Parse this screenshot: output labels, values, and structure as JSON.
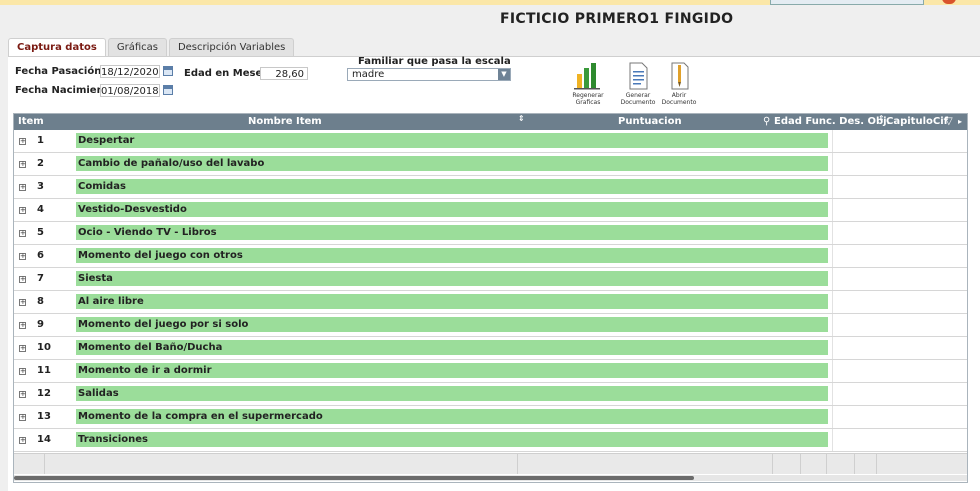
{
  "header": {
    "patient_name": "FICTICIO PRIMERO1 FINGIDO"
  },
  "tabs": [
    {
      "label": "Captura datos",
      "active": true
    },
    {
      "label": "Gráficas",
      "active": false
    },
    {
      "label": "Descripción Variables",
      "active": false
    }
  ],
  "form": {
    "fecha_pasacion_label": "Fecha Pasación",
    "fecha_pasacion_value": "18/12/2020",
    "fecha_nacimiento_label": "Fecha Nacimiento",
    "fecha_nacimiento_value": "01/08/2018",
    "edad_meses_label": "Edad en Meses",
    "edad_meses_value": "28,60",
    "familiar_label": "Familiar que pasa la escala",
    "familiar_value": "madre"
  },
  "toolbar": {
    "regenerar_line1": "Regenerar",
    "regenerar_line2": "Graficas",
    "generar_line1": "Generar",
    "generar_line2": "Documento",
    "abrir_line1": "Abrir",
    "abrir_line2": "Documento"
  },
  "grid": {
    "columns": {
      "item": "Item",
      "nombre": "Nombre Item",
      "puntuacion": "Puntuacion",
      "edad": "Edad Func. Des. Obj.",
      "capitulo": "CapituloCif"
    },
    "rows": [
      {
        "num": "1",
        "name": "Despertar"
      },
      {
        "num": "2",
        "name": "Cambio de pañalo/uso del lavabo"
      },
      {
        "num": "3",
        "name": "Comidas"
      },
      {
        "num": "4",
        "name": "Vestido-Desvestido"
      },
      {
        "num": "5",
        "name": "Ocio - Viendo TV - Libros"
      },
      {
        "num": "6",
        "name": "Momento del juego con otros"
      },
      {
        "num": "7",
        "name": "Siesta"
      },
      {
        "num": "8",
        "name": "Al aire libre"
      },
      {
        "num": "9",
        "name": "Momento del juego por si solo"
      },
      {
        "num": "10",
        "name": "Momento del Baño/Ducha"
      },
      {
        "num": "11",
        "name": "Momento de ir a dormir"
      },
      {
        "num": "12",
        "name": "Salidas"
      },
      {
        "num": "13",
        "name": "Momento de la compra en el supermercado"
      },
      {
        "num": "14",
        "name": "Transiciones"
      }
    ]
  },
  "colors": {
    "accent": "#7a1a12",
    "row_bar": "#9bdd9a",
    "header_bg": "#6d7f8d"
  }
}
